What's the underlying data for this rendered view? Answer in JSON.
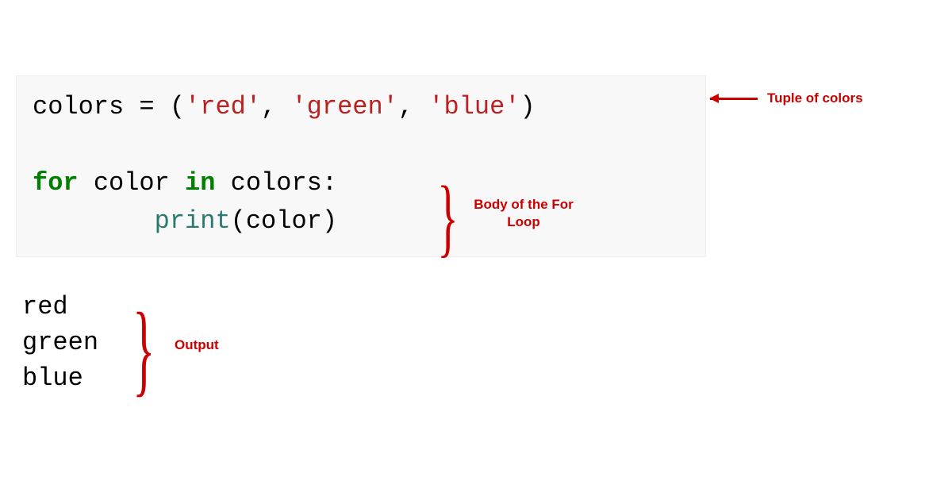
{
  "code": {
    "line1": {
      "var": "colors",
      "assign": " = ",
      "open": "(",
      "s1q": "'",
      "s1": "red",
      "s1q2": "'",
      "c1": ", ",
      "s2q": "'",
      "s2": "green",
      "s2q2": "'",
      "c2": ", ",
      "s3q": "'",
      "s3": "blue",
      "s3q2": "'",
      "close": ")"
    },
    "line2": {
      "for": "for",
      "sp1": " ",
      "iter": "color",
      "sp2": " ",
      "in": "in",
      "sp3": " ",
      "coll": "colors",
      "colon": ":"
    },
    "line3": {
      "indent": "        ",
      "func": "print",
      "open": "(",
      "arg": "color",
      "close": ")"
    }
  },
  "output": {
    "l1": "red",
    "l2": "green",
    "l3": "blue"
  },
  "annotations": {
    "tuple_label": "Tuple of colors",
    "body_label": "Body of the For\nLoop",
    "body_label_line1": "Body of the For",
    "body_label_line2": "Loop",
    "output_label": "Output"
  },
  "braces": {
    "body_brace": "}",
    "output_brace": "}"
  }
}
